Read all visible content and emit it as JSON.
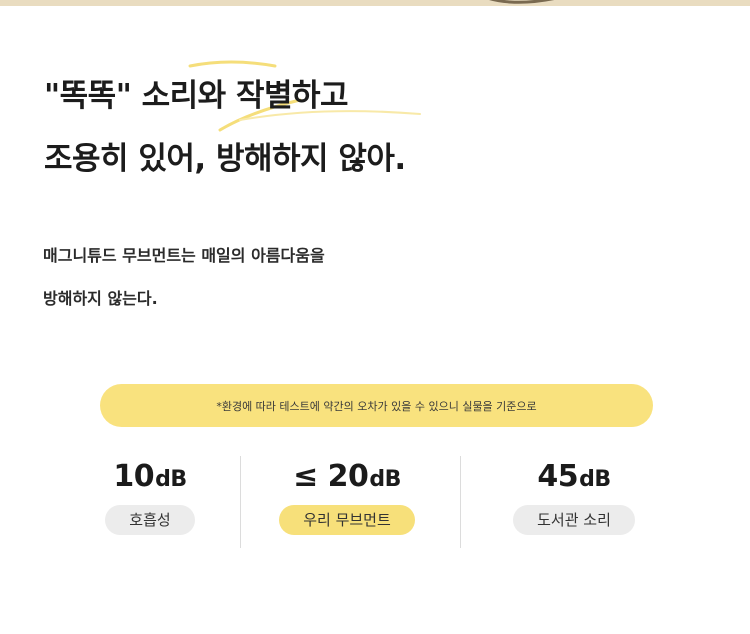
{
  "headline": {
    "line1": "\"똑똑\" 소리와 작별하고",
    "line2": "조용히 있어, 방해하지 않아."
  },
  "subtext": {
    "line1": "매그니튜드 무브먼트는 매일의 아름다움을",
    "line2": "방해하지 않는다."
  },
  "notice": "*환경에 따라 테스트에 약간의 오차가 있을 수 있으니 실물을 기준으로",
  "stats": [
    {
      "prefix": "",
      "number": "10",
      "unit": "dB",
      "label": "호흡성"
    },
    {
      "prefix": "≤ ",
      "number": "20",
      "unit": "dB",
      "label": "우리 무브먼트"
    },
    {
      "prefix": "",
      "number": "45",
      "unit": "dB",
      "label": "도서관 소리"
    }
  ],
  "colors": {
    "accent": "#f9e27e",
    "pill_gray": "#ececec",
    "top_band": "#e9dcc0"
  }
}
